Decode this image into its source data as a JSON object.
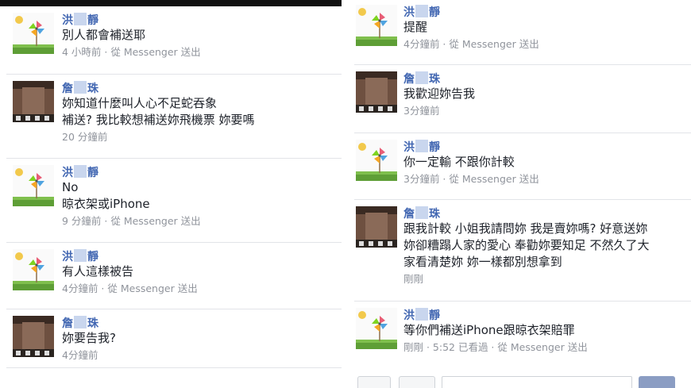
{
  "left_panel": {
    "comments": [
      {
        "name_a": "洪",
        "name_b": "靜",
        "text": "別人都會補送耶",
        "meta": "4 小時前 · 從 Messenger 送出",
        "avatar": "pinwheel"
      },
      {
        "name_a": "詹",
        "name_b": "珠",
        "text": "妳知道什麼叫人心不足蛇吞象\n補送? 我比較想補送妳飛機票 妳要嗎",
        "meta": "20 分鐘前",
        "avatar": "person"
      },
      {
        "name_a": "洪",
        "name_b": "靜",
        "text": "No\n晾衣架或iPhone",
        "meta": "9 分鐘前 · 從 Messenger 送出",
        "avatar": "pinwheel"
      },
      {
        "name_a": "洪",
        "name_b": "靜",
        "text": "有人這樣被告",
        "meta": "4分鐘前 · 從 Messenger 送出",
        "avatar": "pinwheel"
      },
      {
        "name_a": "詹",
        "name_b": "珠",
        "text": "妳要告我?",
        "meta": "4分鐘前",
        "avatar": "person"
      }
    ]
  },
  "right_panel": {
    "comments": [
      {
        "name_a": "洪",
        "name_b": "靜",
        "text": "提醒",
        "meta": "4分鐘前 · 從 Messenger 送出",
        "avatar": "pinwheel"
      },
      {
        "name_a": "詹",
        "name_b": "珠",
        "text": "我歡迎妳告我",
        "meta": "3分鐘前",
        "avatar": "person"
      },
      {
        "name_a": "洪",
        "name_b": "靜",
        "text": "你一定輸 不跟你計較",
        "meta": "3分鐘前 · 從 Messenger 送出",
        "avatar": "pinwheel"
      },
      {
        "name_a": "詹",
        "name_b": "珠",
        "text": "跟我計較 小姐我請問妳 我是賣妳嗎? 好意送妳\n妳卻糟蹋人家的愛心 奉勸妳要知足 不然久了大\n家看清楚妳 妳一樣都別想拿到",
        "meta": "剛剛",
        "avatar": "person"
      },
      {
        "name_a": "洪",
        "name_b": "靜",
        "text": "等你們補送iPhone跟晾衣架賠罪",
        "meta": "剛剛 · 5:52 已看過 · 從 Messenger 送出",
        "avatar": "pinwheel"
      }
    ]
  },
  "colors": {
    "name": "#4267b2",
    "meta": "#90949c",
    "divider": "#e2e4e8"
  }
}
